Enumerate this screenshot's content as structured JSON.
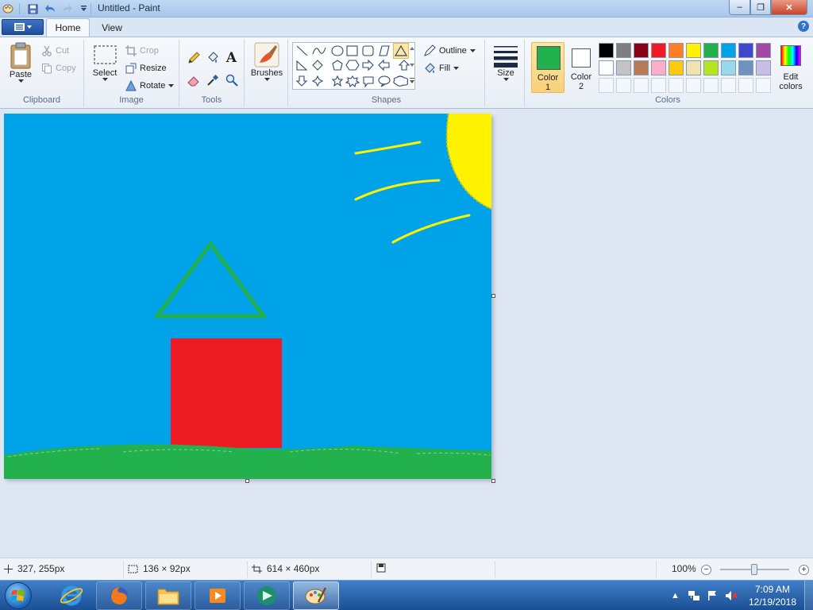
{
  "window": {
    "title": "Untitled - Paint",
    "minimize_glyph": "‒",
    "maximize_glyph": "❐",
    "close_glyph": "✕"
  },
  "tabs": {
    "home": "Home",
    "view": "View"
  },
  "help_glyph": "?",
  "clipboard": {
    "label": "Clipboard",
    "paste": "Paste",
    "cut": "Cut",
    "copy": "Copy"
  },
  "image": {
    "label": "Image",
    "select": "Select",
    "crop": "Crop",
    "resize": "Resize",
    "rotate": "Rotate"
  },
  "tools": {
    "label": "Tools",
    "text_glyph": "A"
  },
  "brushes": {
    "label": "Brushes"
  },
  "shapes": {
    "label": "Shapes",
    "outline": "Outline",
    "fill": "Fill"
  },
  "size": {
    "label": "Size"
  },
  "colors": {
    "label": "Colors",
    "color1_line1": "Color",
    "color1_line2": "1",
    "color2_line1": "Color",
    "color2_line2": "2",
    "edit_line1": "Edit",
    "edit_line2": "colors",
    "color1_value": "#22b14c",
    "color2_value": "#ffffff",
    "palette_row1": [
      "#000000",
      "#7f7f7f",
      "#880015",
      "#ed1c24",
      "#ff7f27",
      "#fff200",
      "#22b14c",
      "#00a2e8",
      "#3f48cc",
      "#a349a4"
    ],
    "palette_row2": [
      "#ffffff",
      "#c3c3c3",
      "#b97a57",
      "#ffaec9",
      "#ffc90e",
      "#efe4b0",
      "#b5e61d",
      "#99d9ea",
      "#7092be",
      "#c8bfe7"
    ]
  },
  "canvas": {
    "sky_color": "#00a2e8",
    "grass_color": "#22b14c",
    "sun_color": "#fff200",
    "house_color": "#ed1c24",
    "roof_color": "#22b14c"
  },
  "status": {
    "cursor_pos": "327, 255px",
    "selection_size": "136 × 92px",
    "canvas_size": "614 × 460px",
    "zoom": "100%",
    "zoom_minus": "−",
    "zoom_plus": "+"
  },
  "taskbar": {
    "time": "7:09 AM",
    "date": "12/19/2018",
    "tray_arrow": "▲"
  }
}
